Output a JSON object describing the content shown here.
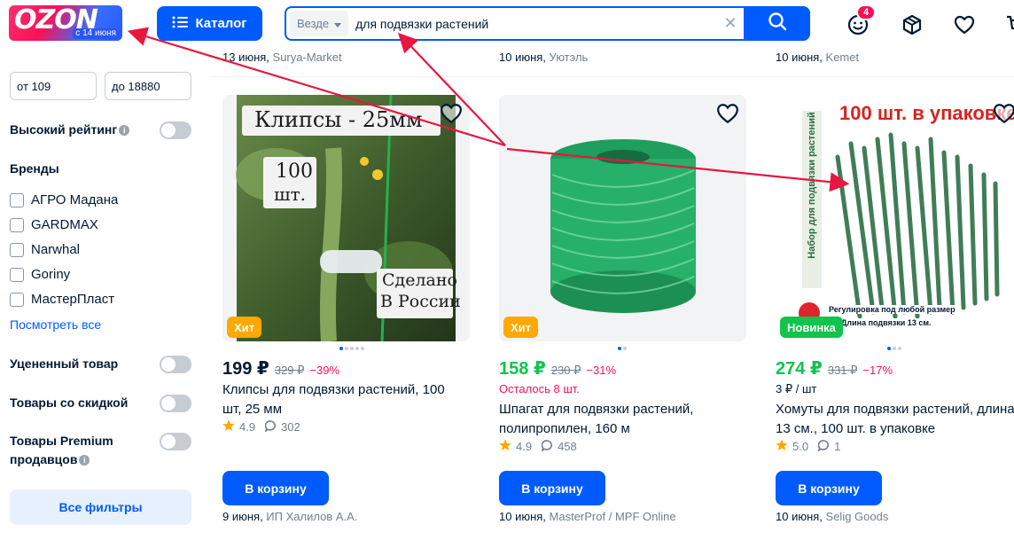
{
  "header": {
    "logo_text": "OZON",
    "logo_sub": "с 14 июня",
    "catalog_label": "Каталог",
    "search_scope": "Везде",
    "search_value": "для подвязки растений",
    "notifications_count": "4"
  },
  "sidebar": {
    "price_from": "от 109",
    "price_to": "до 18880",
    "high_rating_label": "Высокий рейтинг",
    "brands_title": "Бренды",
    "brands": [
      {
        "label": "АГРО Мадана"
      },
      {
        "label": "GARDMAX"
      },
      {
        "label": "Narwhal"
      },
      {
        "label": "Goriny"
      },
      {
        "label": "МастерПласт"
      }
    ],
    "see_all": "Посмотреть все",
    "discounted_label": "Уцененный товар",
    "sale_label": "Товары со скидкой",
    "premium_label_1": "Товары Premium",
    "premium_label_2": "продавцов",
    "all_filters": "Все фильтры"
  },
  "top_row": [
    {
      "date": "13 июня, ",
      "seller": "Surya-Market"
    },
    {
      "date": "10 июня, ",
      "seller": "Уютэль"
    },
    {
      "date": "10 июня, ",
      "seller": "Kemet"
    }
  ],
  "products": [
    {
      "image_caption_1": "Клипсы - 25мм",
      "image_caption_2": "100",
      "image_caption_3": "шт.",
      "image_caption_4": "Сделано",
      "image_caption_5": "В России",
      "tag": "Хит",
      "tag_color": "#ffa800",
      "price": "199 ₽",
      "old_price": "329 ₽",
      "discount": "−39%",
      "title": "Клипсы для подвязки растений, 100 шт, 25 мм",
      "rating": "4.9",
      "reviews": "302",
      "cart": "В корзину",
      "delivery_date": "9 июня, ",
      "seller": "ИП Халилов А.А."
    },
    {
      "tag": "Хит",
      "tag_color": "#ffa800",
      "price": "158 ₽",
      "old_price": "230 ₽",
      "discount": "−31%",
      "stock_note": "Осталось 8 шт.",
      "title": "Шпагат для подвязки растений, полипропилен, 160 м",
      "rating": "4.9",
      "reviews": "458",
      "cart": "В корзину",
      "delivery_date": "10 июня, ",
      "seller": "MasterProf / MPF Online"
    },
    {
      "image_caption_1": "100 шт. в упаковке",
      "image_caption_2": "Набор для подвязки растений",
      "image_caption_3": "Регулировка под любой размер",
      "image_caption_4": "Длина подвязки 13 см.",
      "tag": "Новинка",
      "tag_color": "#10c44c",
      "price": "274 ₽",
      "old_price": "331 ₽",
      "discount": "−17%",
      "unit_price": "3 ₽ / шт",
      "title": "Хомуты для подвязки растений, длина 13 см., 100 шт. в упаковке",
      "rating": "5.0",
      "reviews": "1",
      "cart": "В корзину",
      "delivery_date": "10 июня, ",
      "seller": "Selig Goods"
    }
  ],
  "colors": {
    "accent": "#005bff",
    "price_green": "#10c44c",
    "discount": "#f91155",
    "annotation_arrow": "#e8173f"
  }
}
